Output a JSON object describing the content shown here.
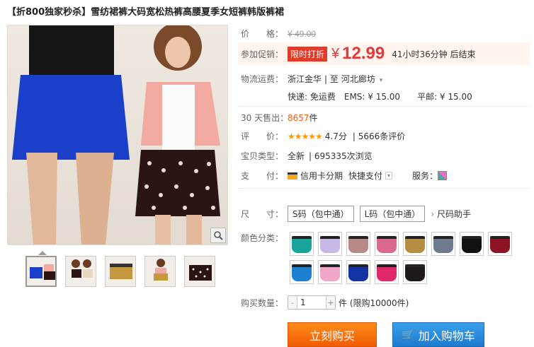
{
  "title": "【折800独家秒杀】雪纺裙裤大码宽松热裤高腰夏季女短裤韩版裤裙",
  "price": {
    "label": "价　　格：",
    "original": "¥ 49.00",
    "promo_label": "参加促销：",
    "badge": "限时打折",
    "currency": "¥",
    "current": "12.99",
    "countdown": "41小时36分钟 后结束"
  },
  "shipping": {
    "label": "物流运费：",
    "from": "浙江金华",
    "to_sep": "| 至",
    "to": "河北廊坊",
    "fees": "快递: 免运费　EMS: ¥ 15.00　　平邮: ¥ 15.00"
  },
  "sales": {
    "label": "30 天售出：",
    "value": "8657",
    "unit": "件"
  },
  "rating": {
    "label": "评　　价：",
    "stars": "★★★★★",
    "score": "4.7分",
    "reviews": "| 5666条评价"
  },
  "item_type": {
    "label": "宝贝类型：",
    "value": "全新",
    "views": "| 695335次浏览"
  },
  "payment": {
    "label": "支　　付：",
    "credit": "信用卡分期",
    "quick": "快捷支付",
    "service_label": "服务："
  },
  "size": {
    "label": "尺　　寸：",
    "options": [
      "S码（包中通）",
      "L码（包中通）"
    ],
    "helper": "尺码助手"
  },
  "color": {
    "label": "颜色分类：",
    "swatches": [
      "#1aa39a",
      "#c9b7e8",
      "#b78a86",
      "#d96a8d",
      "#b58d43",
      "#6d7a8f",
      "#111111",
      "#8d1424",
      "#1e7fd0",
      "#f0a6c8",
      "#1434a3",
      "#e0286a",
      "#1f1a1a"
    ]
  },
  "quantity": {
    "label": "购买数量：",
    "value": "1",
    "minus": "-",
    "plus": "+",
    "unit": "件 (限购10000件)"
  },
  "buttons": {
    "buy": "立刻购买",
    "cart": "加入购物车"
  }
}
